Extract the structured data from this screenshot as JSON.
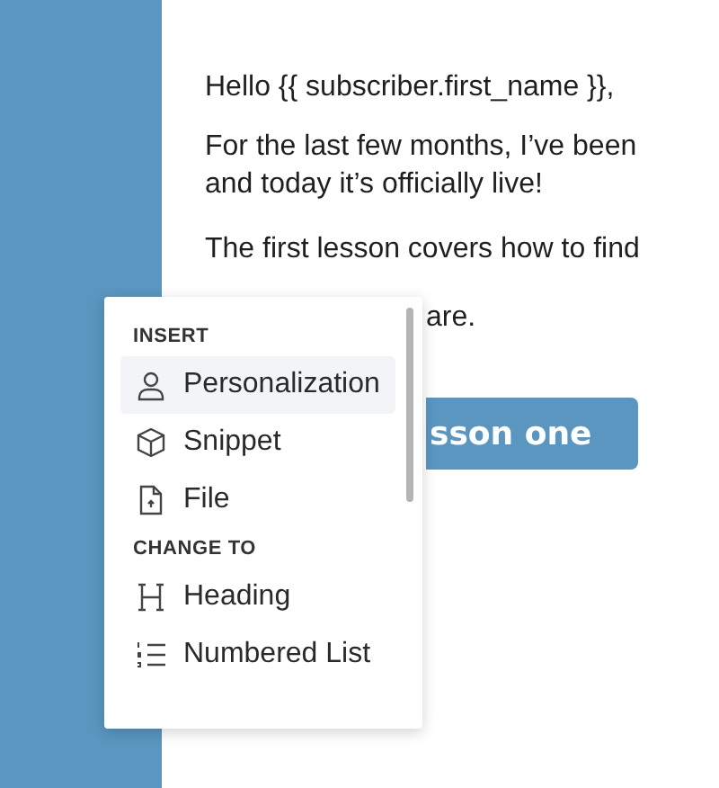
{
  "email": {
    "lines": [
      "Hello {{ subscriber.first_name }},",
      "For the last few months, I’ve been",
      "and today it’s officially live!",
      "The first lesson covers how to find",
      "are."
    ],
    "button": "sson one"
  },
  "menu": {
    "sections": [
      {
        "title": "INSERT",
        "items": [
          {
            "label": "Personalization",
            "selected": true
          },
          {
            "label": "Snippet",
            "selected": false
          },
          {
            "label": "File",
            "selected": false
          }
        ]
      },
      {
        "title": "CHANGE TO",
        "items": [
          {
            "label": "Heading",
            "selected": false
          },
          {
            "label": "Numbered List",
            "selected": false
          }
        ]
      }
    ]
  }
}
